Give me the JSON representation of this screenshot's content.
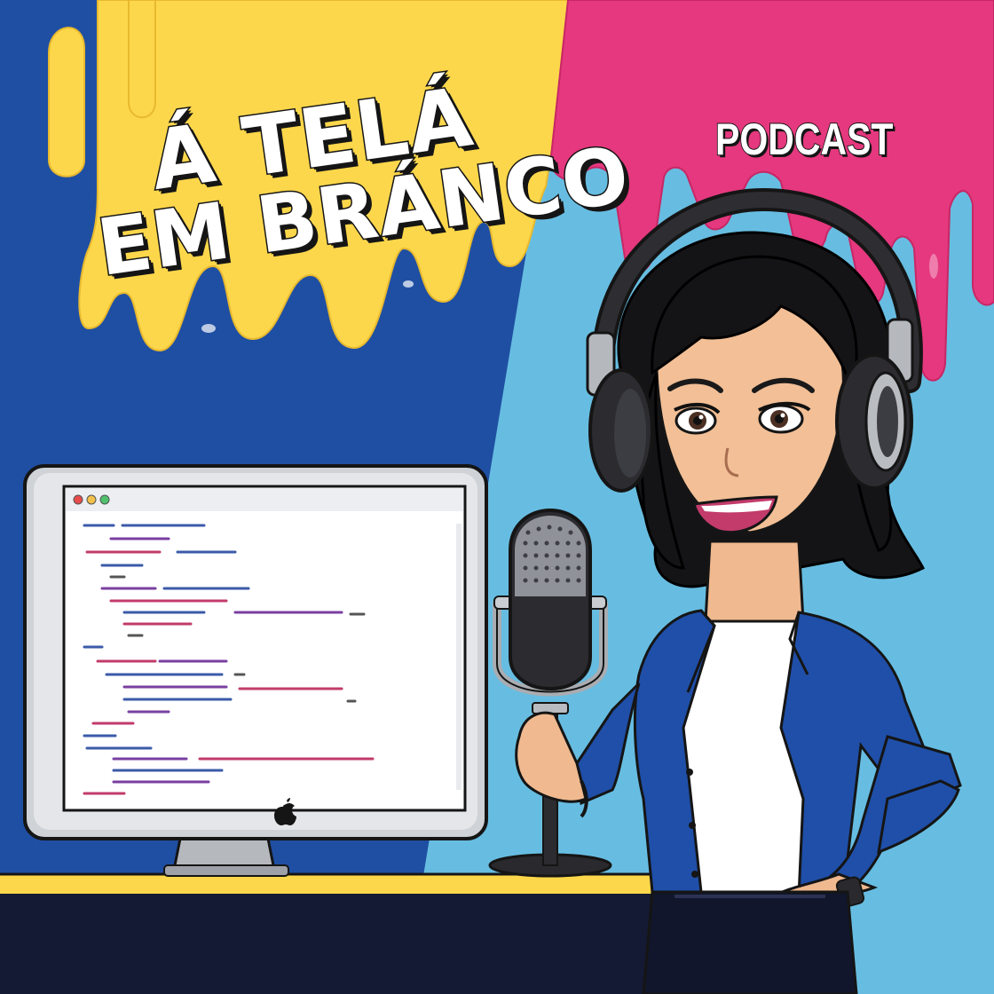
{
  "cover": {
    "title_line_1": "Á TELÁ",
    "title_line_2": "EM BRÁNCO",
    "label": "PODCAST"
  },
  "monitor": {
    "window_buttons": [
      "close",
      "minimize",
      "zoom"
    ],
    "logo": "apple-logo-icon"
  },
  "icons": {
    "microphone": "microphone-icon",
    "headphones": "headphones-icon",
    "watch": "wristwatch-icon",
    "logo": "apple-logo-icon"
  },
  "colors": {
    "dark_blue": "#1f4fa3",
    "yellow": "#fdd74b",
    "pink": "#e5387e",
    "light_blue": "#67bde1",
    "navy_desk": "#141a33",
    "jacket_blue": "#1f4fa8"
  }
}
